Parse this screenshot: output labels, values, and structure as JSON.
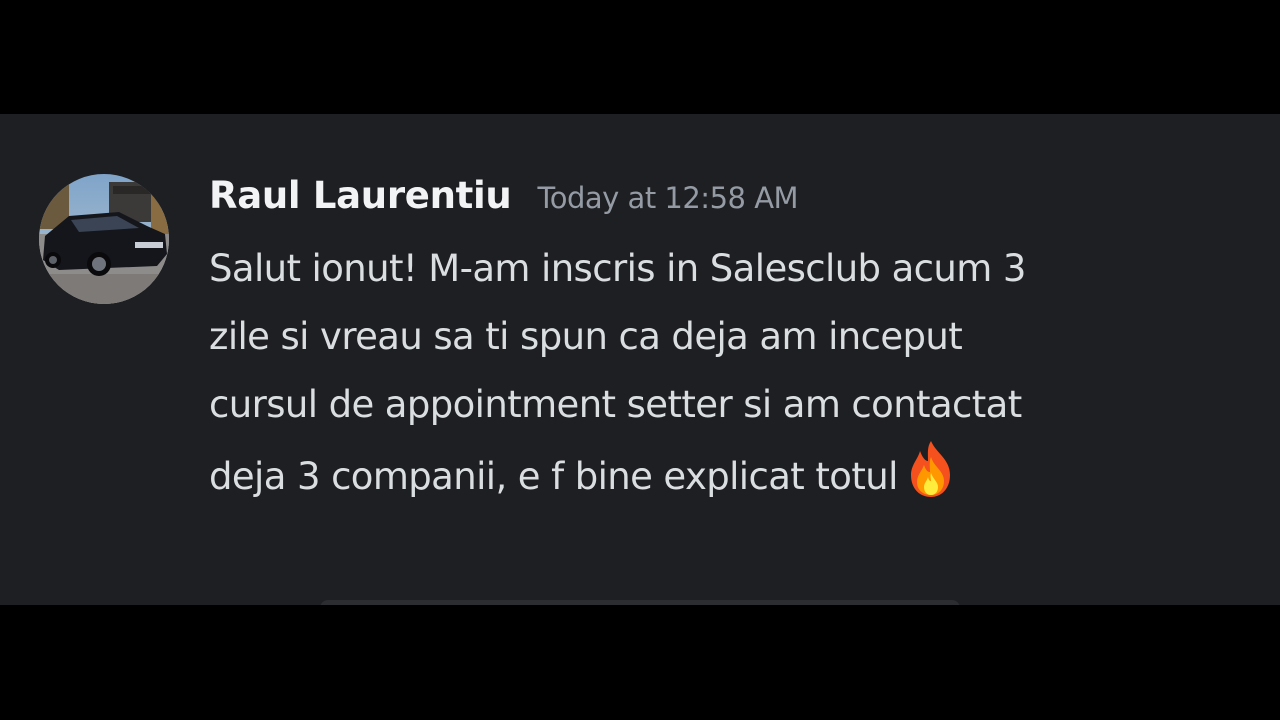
{
  "message": {
    "author": "Raul Laurentiu",
    "timestamp": "Today at 12:58 AM",
    "lines": [
      "Salut ionut! M-am inscris in Salesclub acum 3",
      "zile si vreau sa ti spun ca deja am inceput",
      "cursul de appointment setter si am contactat",
      "deja 3 companii, e f bine explicat totul"
    ],
    "emoji": "fire-icon"
  },
  "colors": {
    "background": "#1e1f22",
    "letterbox": "#000000",
    "username": "#f2f3f5",
    "timestamp": "#949ba4",
    "text": "#dbdee1"
  }
}
